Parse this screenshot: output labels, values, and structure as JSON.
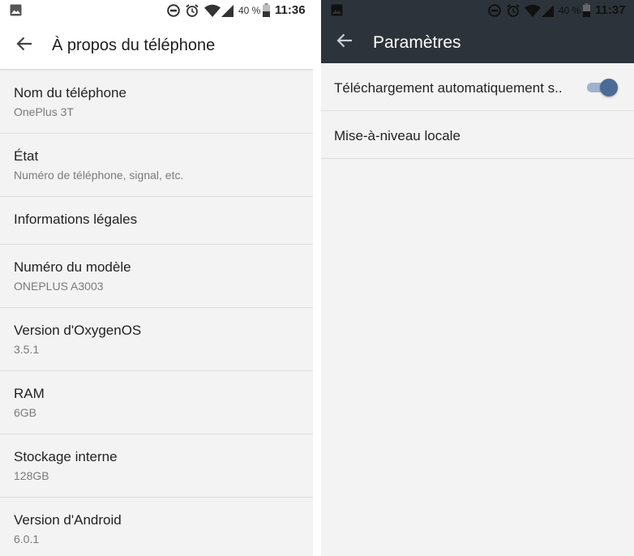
{
  "left": {
    "status_bar": {
      "battery_text": "40 %",
      "time": "11:36",
      "icons": [
        "image-notification-icon",
        "do-not-disturb-icon",
        "alarm-icon",
        "wifi-icon",
        "signal-icon",
        "battery-icon"
      ]
    },
    "toolbar": {
      "title": "À propos du téléphone"
    },
    "items": [
      {
        "title": "Nom du téléphone",
        "subtitle": "OnePlus 3T"
      },
      {
        "title": "État",
        "subtitle": "Numéro de téléphone, signal, etc."
      },
      {
        "title": "Informations légales"
      },
      {
        "title": "Numéro du modèle",
        "subtitle": "ONEPLUS A3003"
      },
      {
        "title": "Version d'OxygenOS",
        "subtitle": "3.5.1"
      },
      {
        "title": "RAM",
        "subtitle": "6GB"
      },
      {
        "title": "Stockage interne",
        "subtitle": "128GB"
      },
      {
        "title": "Version d'Android",
        "subtitle": "6.0.1"
      }
    ]
  },
  "right": {
    "status_bar": {
      "battery_text": "40 %",
      "time": "11:37",
      "icons": [
        "image-notification-icon",
        "do-not-disturb-icon",
        "alarm-icon",
        "wifi-icon",
        "signal-icon",
        "battery-icon"
      ]
    },
    "toolbar": {
      "title": "Paramètres"
    },
    "items": [
      {
        "title": "Téléchargement automatiquement s..",
        "toggle_on": true
      },
      {
        "title": "Mise-à-niveau locale"
      }
    ]
  },
  "colors": {
    "dark_toolbar": "#2c333a",
    "toggle_thumb": "#4c6a96",
    "toggle_track": "#9fb3cf",
    "background": "#f3f3f3"
  }
}
